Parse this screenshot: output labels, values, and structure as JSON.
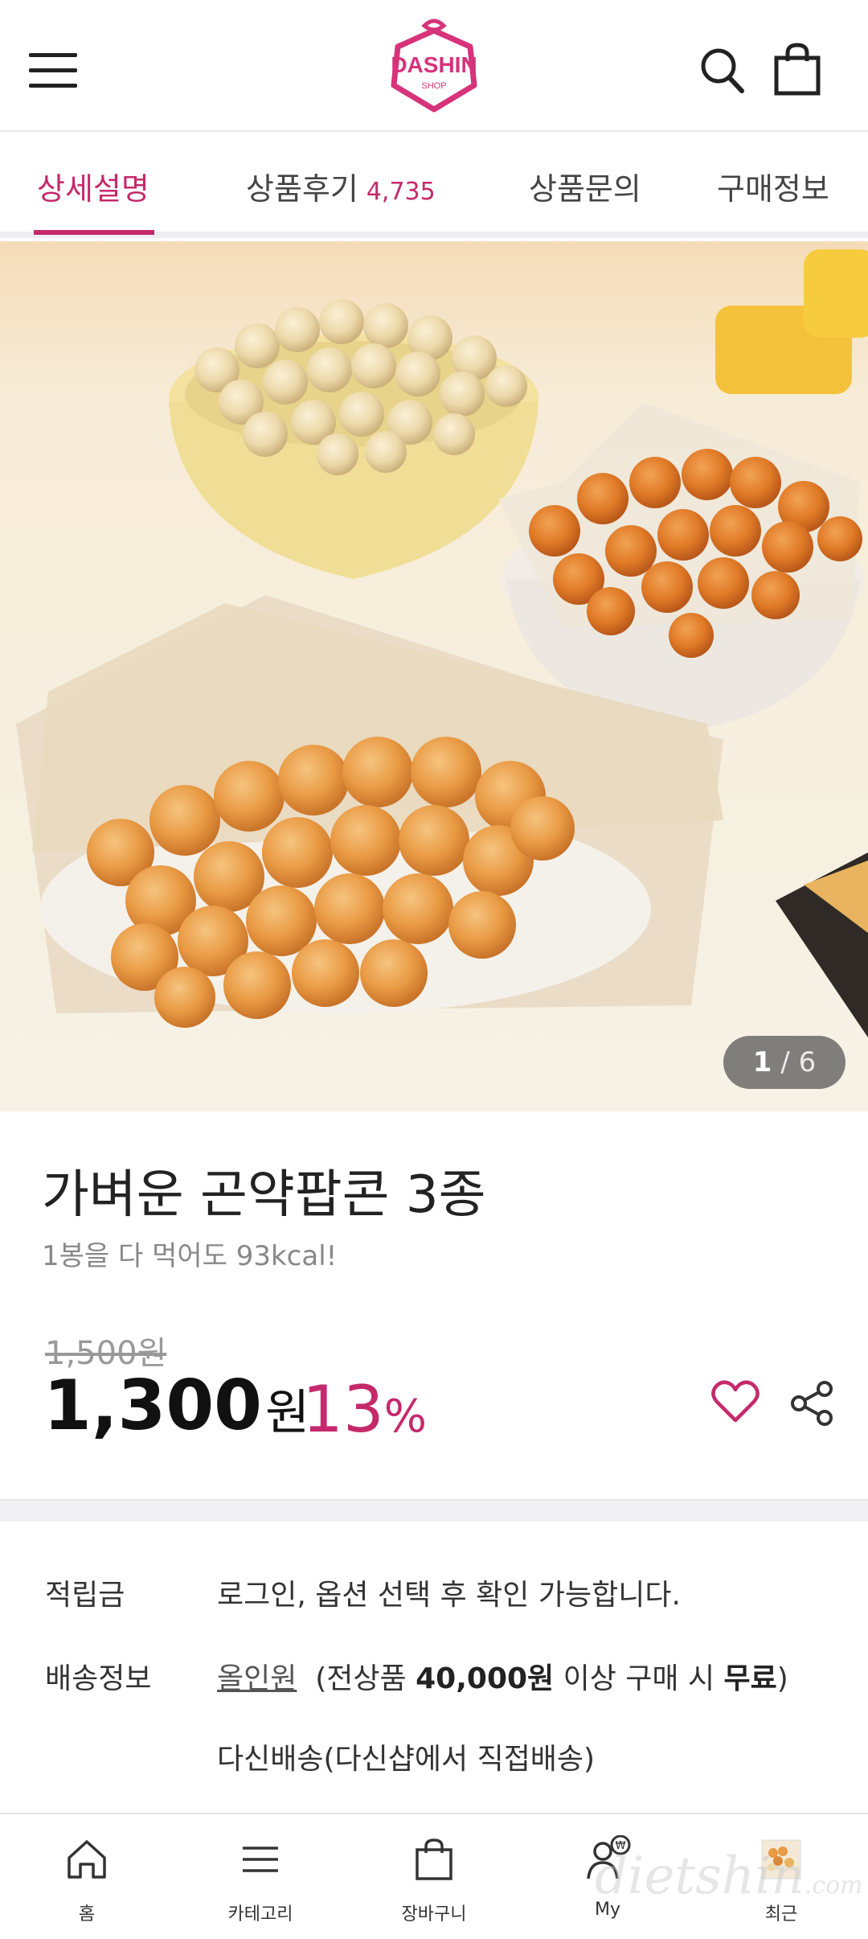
{
  "header": {
    "logo_text": "DASHIN",
    "logo_sub": "SHOP"
  },
  "tabs": [
    {
      "label": "상세설명",
      "active": true
    },
    {
      "label": "상품후기",
      "count": "4,735"
    },
    {
      "label": "상품문의"
    },
    {
      "label": "구매정보"
    }
  ],
  "gallery": {
    "current": "1",
    "separator": "/",
    "total": "6"
  },
  "product": {
    "title": "가벼운 곤약팝콘 3종",
    "subtitle": "1봉을 다 먹어도 93kcal!",
    "original_price": "1,500",
    "original_unit": "원",
    "price": "1,300",
    "price_unit": "원",
    "discount": "13",
    "discount_unit": "%"
  },
  "details": {
    "points_label": "적립금",
    "points_value": "로그인, 옵션 선택 후 확인 가능합니다.",
    "shipping_label": "배송정보",
    "shipping_link": "올인원",
    "shipping_pre": "(전상품 ",
    "shipping_amount": "40,000원",
    "shipping_mid": " 이상 구매 시 ",
    "shipping_free": "무료",
    "shipping_post": ")",
    "shipping_method": "다신배송(다신샵에서 직접배송)"
  },
  "bottom_nav": [
    {
      "label": "홈",
      "icon": "home-icon"
    },
    {
      "label": "카테고리",
      "icon": "menu-icon"
    },
    {
      "label": "장바구니",
      "icon": "bag-icon"
    },
    {
      "label": "My",
      "icon": "user-won-icon"
    },
    {
      "label": "최근",
      "icon": "recent-thumbnail"
    }
  ],
  "watermark": {
    "text": "dietshin",
    "suffix": ".com"
  },
  "colors": {
    "accent": "#c42a6b",
    "text": "#222222",
    "muted": "#888888"
  }
}
